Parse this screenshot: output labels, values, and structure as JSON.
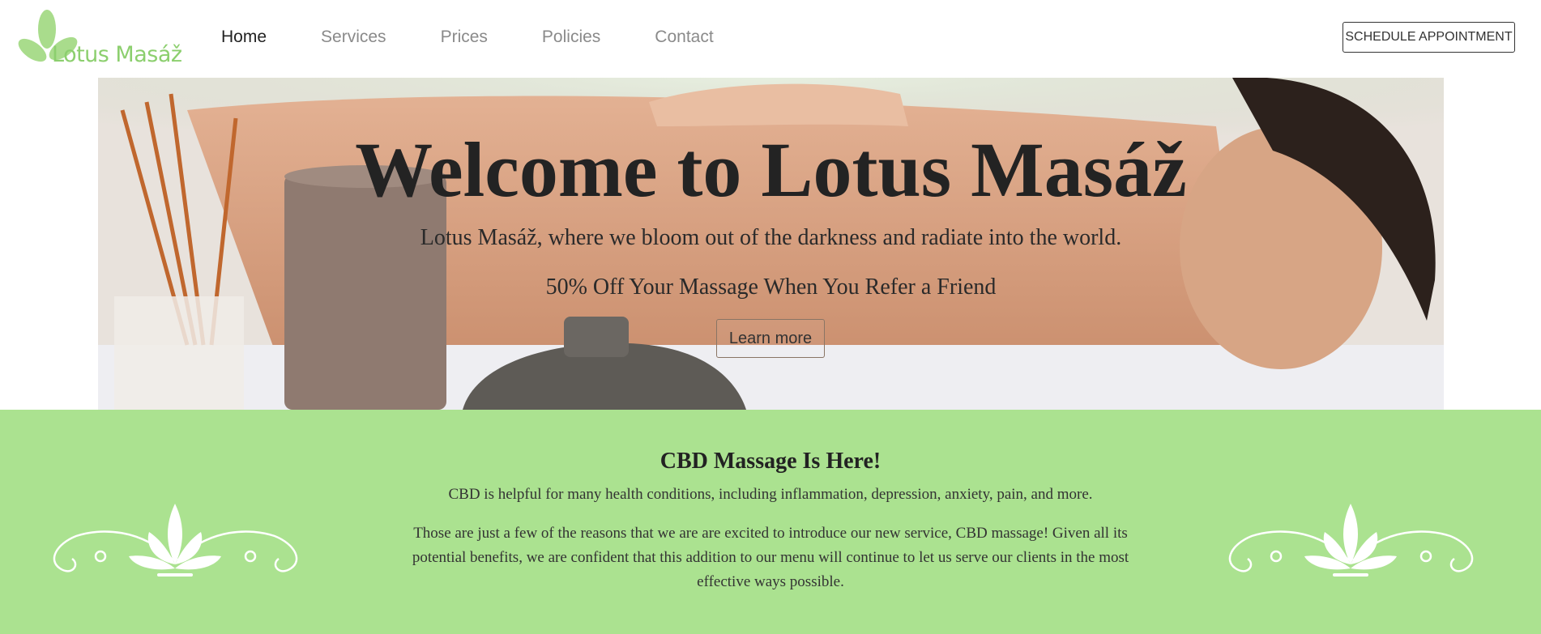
{
  "brand": {
    "name": "Lotus Masáž",
    "logo_icon": "lotus-leaf-icon",
    "accent_color": "#8ccf6e"
  },
  "nav": {
    "items": [
      {
        "label": "Home",
        "active": true
      },
      {
        "label": "Services",
        "active": false
      },
      {
        "label": "Prices",
        "active": false
      },
      {
        "label": "Policies",
        "active": false
      },
      {
        "label": "Contact",
        "active": false
      }
    ],
    "schedule_label": "SCHEDULE APPOINTMENT"
  },
  "hero": {
    "title": "Welcome to Lotus Masáž",
    "subtitle": "Lotus Masáž, where we bloom out of the darkness and radiate into the world.",
    "promo": "50% Off Your Massage When You Refer a Friend",
    "button_label": "Learn more"
  },
  "cbd": {
    "title": "CBD Massage Is Here!",
    "line": "CBD is helpful for many health conditions, including inflammation, depression, anxiety, pain, and more.",
    "paragraph": "Those are just a few of the reasons that we are are excited to introduce our new service, CBD massage! Given all its potential benefits, we are confident that this addition to our menu will continue to let us serve our clients in the most effective ways possible.",
    "background_color": "#abe290",
    "ornament_icon": "lotus-ornament-icon"
  }
}
